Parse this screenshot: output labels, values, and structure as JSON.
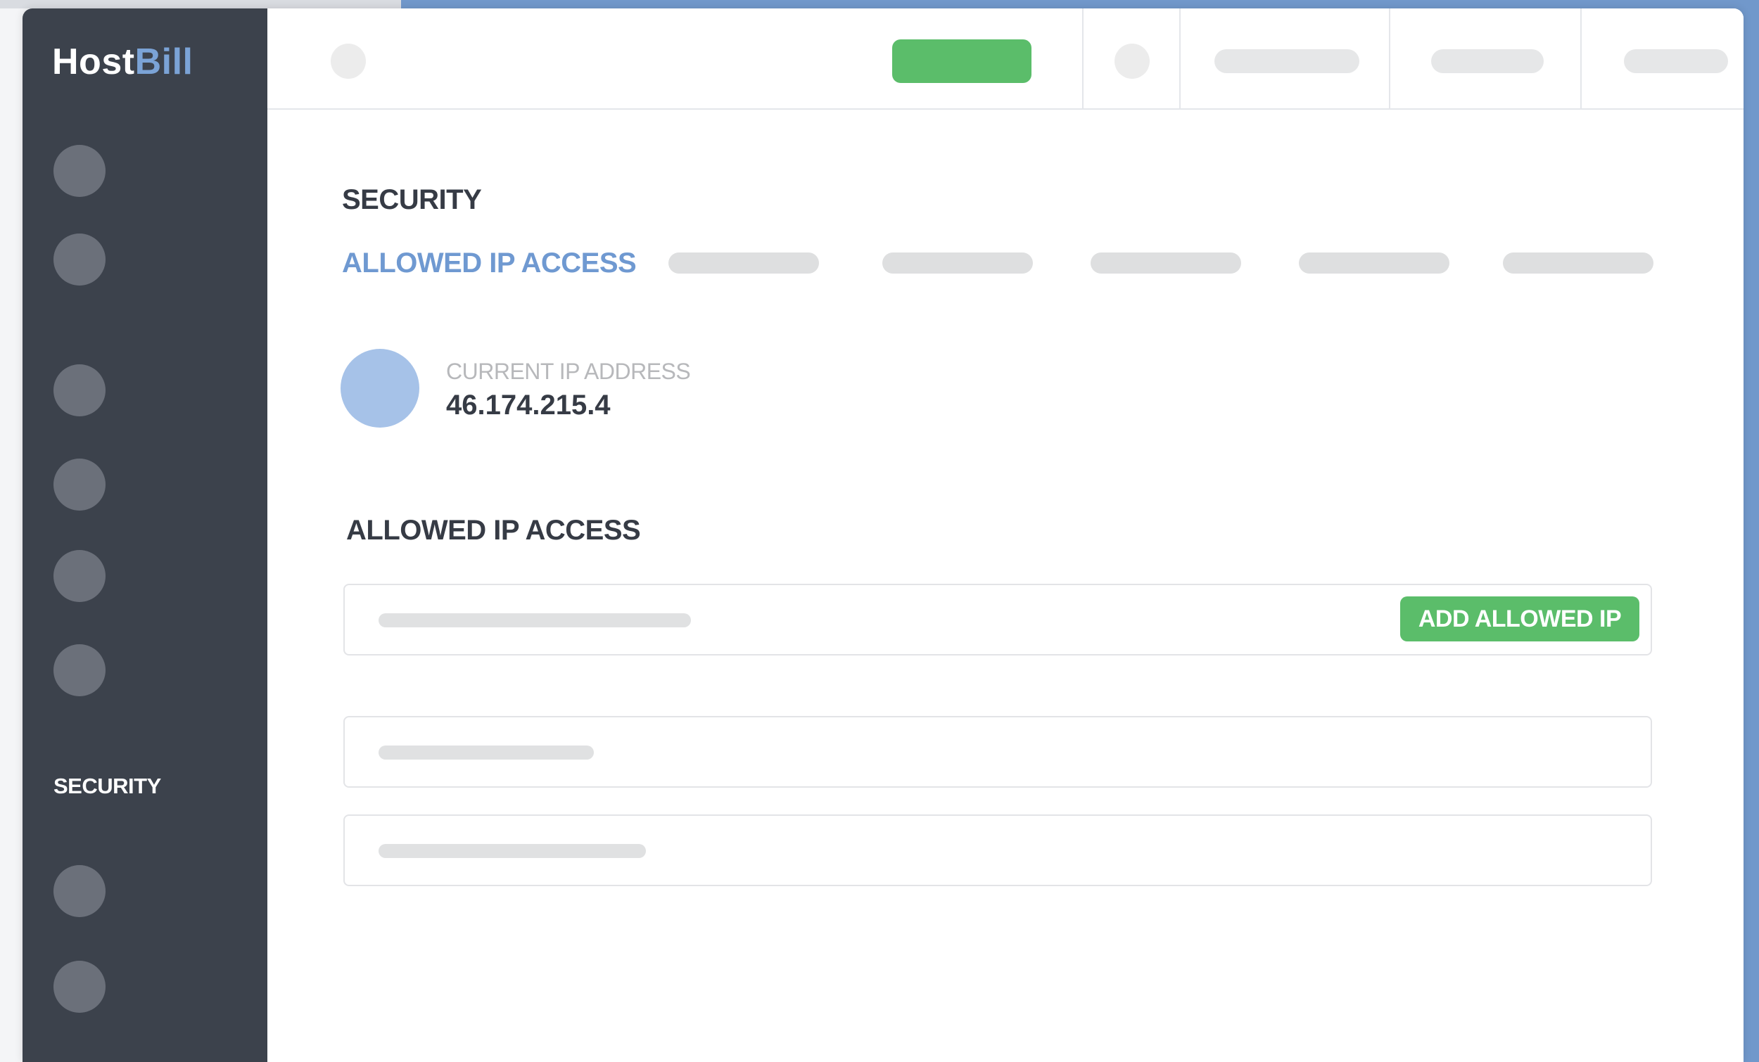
{
  "app": {
    "logo_part1": "Host",
    "logo_part2": "Bill"
  },
  "colors": {
    "sidebar_bg": "#3c424c",
    "accent_blue": "#6f99d1",
    "accent_green": "#5bbd6a",
    "frame_blue": "#7198cb"
  },
  "sidebar": {
    "active_label": "SECURITY"
  },
  "page": {
    "section_title": "SECURITY",
    "active_tab": "ALLOWED IP ACCESS"
  },
  "current_ip": {
    "label": "CURRENT IP ADDRESS",
    "value": "46.174.215.4"
  },
  "allowed_list": {
    "title": "ALLOWED IP ACCESS",
    "add_button": "ADD ALLOWED IP"
  }
}
